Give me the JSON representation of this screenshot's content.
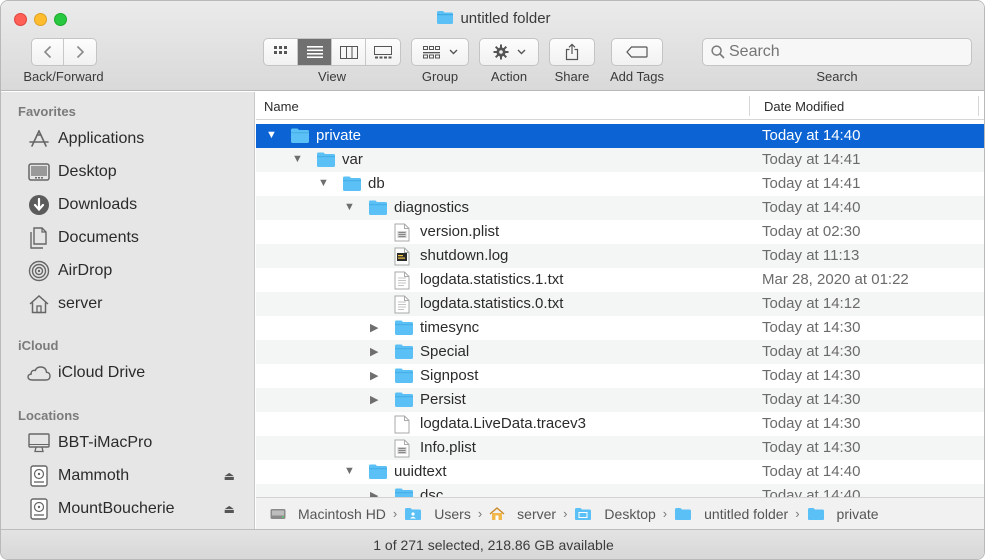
{
  "window": {
    "title": "untitled folder"
  },
  "toolbar": {
    "back_forward_label": "Back/Forward",
    "view_label": "View",
    "group_label": "Group",
    "action_label": "Action",
    "share_label": "Share",
    "add_tags_label": "Add Tags",
    "search_label": "Search",
    "search_placeholder": "Search",
    "active_view": "list"
  },
  "sidebar": {
    "favorites_heading": "Favorites",
    "favorites": [
      {
        "label": "Applications",
        "icon": "applications-icon"
      },
      {
        "label": "Desktop",
        "icon": "desktop-icon"
      },
      {
        "label": "Downloads",
        "icon": "downloads-icon"
      },
      {
        "label": "Documents",
        "icon": "documents-icon"
      },
      {
        "label": "AirDrop",
        "icon": "airdrop-icon"
      },
      {
        "label": "server",
        "icon": "home-icon"
      }
    ],
    "icloud_heading": "iCloud",
    "icloud": [
      {
        "label": "iCloud Drive",
        "icon": "cloud-icon"
      }
    ],
    "locations_heading": "Locations",
    "locations": [
      {
        "label": "BBT-iMacPro",
        "icon": "imac-icon"
      },
      {
        "label": "Mammoth",
        "icon": "disk-icon",
        "eject": true
      },
      {
        "label": "MountBoucherie",
        "icon": "disk-icon",
        "eject": true
      }
    ]
  },
  "columns": {
    "name": "Name",
    "date_modified": "Date Modified"
  },
  "files": [
    {
      "name": "private",
      "date": "Today at 14:40",
      "kind": "folder",
      "depth": 0,
      "disclosure": "open",
      "selected": true
    },
    {
      "name": "var",
      "date": "Today at 14:41",
      "kind": "folder",
      "depth": 1,
      "disclosure": "open"
    },
    {
      "name": "db",
      "date": "Today at 14:41",
      "kind": "folder",
      "depth": 2,
      "disclosure": "open"
    },
    {
      "name": "diagnostics",
      "date": "Today at 14:40",
      "kind": "folder",
      "depth": 3,
      "disclosure": "open"
    },
    {
      "name": "version.plist",
      "date": "Today at 02:30",
      "kind": "plist",
      "depth": 4,
      "disclosure": "none"
    },
    {
      "name": "shutdown.log",
      "date": "Today at 11:13",
      "kind": "log",
      "depth": 4,
      "disclosure": "none"
    },
    {
      "name": "logdata.statistics.1.txt",
      "date": "Mar 28, 2020 at 01:22",
      "kind": "text",
      "depth": 4,
      "disclosure": "none"
    },
    {
      "name": "logdata.statistics.0.txt",
      "date": "Today at 14:12",
      "kind": "text",
      "depth": 4,
      "disclosure": "none"
    },
    {
      "name": "timesync",
      "date": "Today at 14:30",
      "kind": "folder",
      "depth": 4,
      "disclosure": "closed"
    },
    {
      "name": "Special",
      "date": "Today at 14:30",
      "kind": "folder",
      "depth": 4,
      "disclosure": "closed"
    },
    {
      "name": "Signpost",
      "date": "Today at 14:30",
      "kind": "folder",
      "depth": 4,
      "disclosure": "closed"
    },
    {
      "name": "Persist",
      "date": "Today at 14:30",
      "kind": "folder",
      "depth": 4,
      "disclosure": "closed"
    },
    {
      "name": "logdata.LiveData.tracev3",
      "date": "Today at 14:30",
      "kind": "blank",
      "depth": 4,
      "disclosure": "none"
    },
    {
      "name": "Info.plist",
      "date": "Today at 14:30",
      "kind": "plist",
      "depth": 4,
      "disclosure": "none"
    },
    {
      "name": "uuidtext",
      "date": "Today at 14:40",
      "kind": "folder",
      "depth": 3,
      "disclosure": "open"
    },
    {
      "name": "dsc",
      "date": "Today at 14:40",
      "kind": "folder",
      "depth": 4,
      "disclosure": "closed"
    }
  ],
  "pathbar": [
    {
      "label": "Macintosh HD",
      "icon": "hard-drive-icon"
    },
    {
      "label": "Users",
      "icon": "users-folder-icon"
    },
    {
      "label": "server",
      "icon": "home-icon"
    },
    {
      "label": "Desktop",
      "icon": "desktop-folder-icon"
    },
    {
      "label": "untitled folder",
      "icon": "folder-icon"
    },
    {
      "label": "private",
      "icon": "folder-icon"
    }
  ],
  "status": {
    "text": "1 of 271 selected, 218.86 GB available"
  },
  "colors": {
    "selection": "#0b63d4",
    "folder": "#5ac0f5",
    "sidebar_bg": "#e6e6e6"
  }
}
